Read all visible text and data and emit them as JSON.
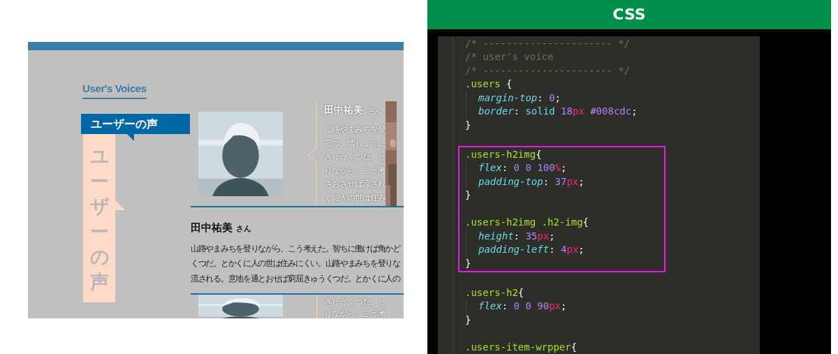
{
  "webpage": {
    "heading": "User's Voices",
    "tag": "ユーザーの声",
    "vertical_title": "ユーザーの声",
    "cards": [
      {
        "name": "田中祐美",
        "honorific": "さん",
        "lines": [
          "山路やまみちを登",
          "立つ。情じょうに",
          "きゅうくつだ。と",
          "りながら、こう考",
          "さおさせば流され",
          "くに人の世は住み"
        ]
      }
    ],
    "feature": {
      "name": "田中祐美",
      "honorific": "さん",
      "lines": [
        "山路やまみちを登りながら、こう考えた。智ちに働けば角かど",
        "くつだ。とかくに人の世は住みにくい。山路やまみちを登りな",
        "流される。意地を通とおせば窮屈きゅうくつだ。とかくに人の"
      ]
    },
    "bottom_lines": [
      "きゅうくつだ。と",
      "りながら、こう考"
    ]
  },
  "code_panel": {
    "title": "CSS",
    "lines": [
      {
        "kind": "code",
        "indented": false,
        "highlighted": false,
        "tokens": [
          {
            "kind": "comment",
            "text": "/* ---------------------- */"
          }
        ]
      },
      {
        "kind": "code",
        "indented": false,
        "highlighted": false,
        "tokens": [
          {
            "kind": "comment",
            "text": "/* user's voice"
          }
        ]
      },
      {
        "kind": "code",
        "indented": false,
        "highlighted": false,
        "tokens": [
          {
            "kind": "comment",
            "text": "/* ---------------------- */"
          }
        ]
      },
      {
        "kind": "code",
        "indented": false,
        "highlighted": false,
        "tokens": [
          {
            "kind": "selector",
            "text": ".users "
          },
          {
            "kind": "punct",
            "text": "{"
          }
        ]
      },
      {
        "kind": "code",
        "indented": true,
        "highlighted": false,
        "tokens": [
          {
            "kind": "property",
            "text": "margin-top"
          },
          {
            "kind": "punct",
            "text": ": "
          },
          {
            "kind": "number",
            "text": "0"
          },
          {
            "kind": "punct",
            "text": ";"
          }
        ]
      },
      {
        "kind": "code",
        "indented": true,
        "highlighted": false,
        "tokens": [
          {
            "kind": "property",
            "text": "border"
          },
          {
            "kind": "punct",
            "text": ": "
          },
          {
            "kind": "value",
            "text": "solid "
          },
          {
            "kind": "number",
            "text": "18"
          },
          {
            "kind": "unit",
            "text": "px "
          },
          {
            "kind": "number",
            "text": "#008cdc"
          },
          {
            "kind": "punct",
            "text": ";"
          }
        ]
      },
      {
        "kind": "code",
        "indented": false,
        "highlighted": false,
        "tokens": [
          {
            "kind": "punct",
            "text": "}"
          }
        ]
      },
      {
        "kind": "blank"
      },
      {
        "kind": "code",
        "indented": false,
        "highlighted": true,
        "tokens": [
          {
            "kind": "selector",
            "text": ".users-h2img"
          },
          {
            "kind": "punct",
            "text": "{"
          }
        ]
      },
      {
        "kind": "code",
        "indented": true,
        "highlighted": true,
        "tokens": [
          {
            "kind": "property",
            "text": "flex"
          },
          {
            "kind": "punct",
            "text": ": "
          },
          {
            "kind": "number",
            "text": "0 0 100"
          },
          {
            "kind": "unit",
            "text": "%"
          },
          {
            "kind": "punct",
            "text": ";"
          }
        ]
      },
      {
        "kind": "code",
        "indented": true,
        "highlighted": true,
        "tokens": [
          {
            "kind": "property",
            "text": "padding-top"
          },
          {
            "kind": "punct",
            "text": ": "
          },
          {
            "kind": "number",
            "text": "37"
          },
          {
            "kind": "unit",
            "text": "px"
          },
          {
            "kind": "punct",
            "text": ";"
          }
        ]
      },
      {
        "kind": "code",
        "indented": false,
        "highlighted": true,
        "tokens": [
          {
            "kind": "punct",
            "text": "}"
          }
        ]
      },
      {
        "kind": "blank"
      },
      {
        "kind": "code",
        "indented": false,
        "highlighted": true,
        "tokens": [
          {
            "kind": "selector",
            "text": ".users-h2img .h2-img"
          },
          {
            "kind": "punct",
            "text": "{"
          }
        ]
      },
      {
        "kind": "code",
        "indented": true,
        "highlighted": true,
        "tokens": [
          {
            "kind": "property",
            "text": "height"
          },
          {
            "kind": "punct",
            "text": ": "
          },
          {
            "kind": "number",
            "text": "35"
          },
          {
            "kind": "unit",
            "text": "px"
          },
          {
            "kind": "punct",
            "text": ";"
          }
        ]
      },
      {
        "kind": "code",
        "indented": true,
        "highlighted": true,
        "tokens": [
          {
            "kind": "property",
            "text": "padding-left"
          },
          {
            "kind": "punct",
            "text": ": "
          },
          {
            "kind": "number",
            "text": "4"
          },
          {
            "kind": "unit",
            "text": "px"
          },
          {
            "kind": "punct",
            "text": ";"
          }
        ]
      },
      {
        "kind": "code",
        "indented": false,
        "highlighted": true,
        "tokens": [
          {
            "kind": "punct",
            "text": "}"
          }
        ]
      },
      {
        "kind": "blank"
      },
      {
        "kind": "code",
        "indented": false,
        "highlighted": false,
        "tokens": [
          {
            "kind": "selector",
            "text": ".users-h2"
          },
          {
            "kind": "punct",
            "text": "{"
          }
        ]
      },
      {
        "kind": "code",
        "indented": true,
        "highlighted": false,
        "tokens": [
          {
            "kind": "property",
            "text": "flex"
          },
          {
            "kind": "punct",
            "text": ": "
          },
          {
            "kind": "number",
            "text": "0 0 90"
          },
          {
            "kind": "unit",
            "text": "px"
          },
          {
            "kind": "punct",
            "text": ";"
          }
        ]
      },
      {
        "kind": "code",
        "indented": false,
        "highlighted": false,
        "tokens": [
          {
            "kind": "punct",
            "text": "}"
          }
        ]
      },
      {
        "kind": "blank"
      },
      {
        "kind": "code",
        "indented": false,
        "highlighted": false,
        "tokens": [
          {
            "kind": "selector",
            "text": ".users-item-wrpper"
          },
          {
            "kind": "punct",
            "text": "{"
          }
        ]
      }
    ]
  }
}
